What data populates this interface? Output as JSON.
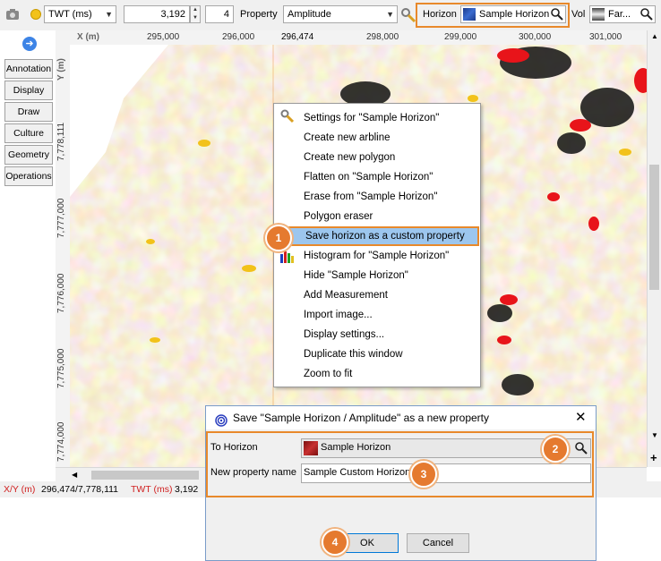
{
  "toolbar": {
    "domain_select": "TWT (ms)",
    "position_value": "3,192",
    "step_value": "4",
    "property_label": "Property",
    "property_select": "Amplitude",
    "horizon_label": "Horizon",
    "horizon_value": "Sample Horizon",
    "vol_label": "Vol",
    "vol_value": "Far..."
  },
  "side_tabs": [
    "Annotation",
    "Display",
    "Draw",
    "Culture",
    "Geometry",
    "Operations"
  ],
  "map": {
    "x_axis_label": "X (m)",
    "y_axis_label": "Y (m)",
    "x_ticks": [
      "295,000",
      "296,000",
      "296,474",
      "298,000",
      "299,000",
      "300,000",
      "301,000"
    ],
    "y_ticks": [
      "7,778,111",
      "7,777,000",
      "7,776,000",
      "7,775,000",
      "7,774,000"
    ]
  },
  "status": {
    "xy_label": "X/Y (m)",
    "xy_value": "296,474/7,778,111",
    "twt_label": "TWT (ms)",
    "twt_value": "3,192"
  },
  "context_menu": {
    "items": [
      "Settings for \"Sample Horizon\"",
      "Create new arbline",
      "Create new polygon",
      "Flatten on \"Sample Horizon\"",
      "Erase from \"Sample Horizon\"",
      "Polygon eraser",
      "Save horizon as a custom property",
      "Histogram for \"Sample Horizon\"",
      "Hide \"Sample Horizon\"",
      "Add Measurement",
      "Import image...",
      "Display settings...",
      "Duplicate this window",
      "Zoom to fit"
    ]
  },
  "dialog": {
    "title": "Save \"Sample Horizon / Amplitude\" as a new property",
    "to_horizon_label": "To Horizon",
    "to_horizon_value": "Sample Horizon",
    "new_name_label": "New property name",
    "new_name_value": "Sample Custom Horizon",
    "ok_label": "OK",
    "cancel_label": "Cancel"
  },
  "badges": [
    "1",
    "2",
    "3",
    "4"
  ],
  "colors": {
    "accent_orange": "#e8892b",
    "selection_blue": "#9cc6ee",
    "badge_orange": "#e57a2f"
  }
}
